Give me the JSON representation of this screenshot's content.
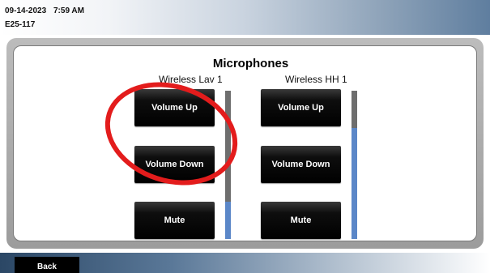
{
  "header": {
    "date": "09-14-2023",
    "time": "7:59 AM",
    "room": "E25-117"
  },
  "page": {
    "title": "Microphones"
  },
  "channels": [
    {
      "label": "Wireless Lav 1",
      "buttons": [
        "Volume Up",
        "Volume Down",
        "Mute"
      ],
      "volume_level": 0.25
    },
    {
      "label": "Wireless HH 1",
      "buttons": [
        "Volume Up",
        "Volume Down",
        "Mute"
      ],
      "volume_level": 0.75
    }
  ],
  "footer": {
    "back_label": "Back"
  },
  "colors": {
    "annotation": "#e31c1c",
    "volume_fill": "#5b87c8",
    "volume_empty": "#6e6e6e"
  }
}
